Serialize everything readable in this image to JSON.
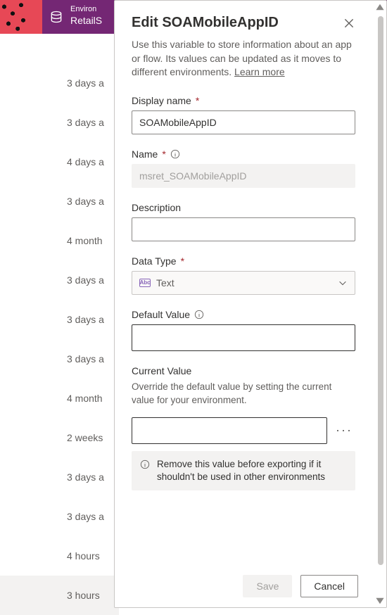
{
  "header": {
    "env_label": "Environ",
    "env_name": "RetailS"
  },
  "bg_list": {
    "items": [
      {
        "time": "3 days a"
      },
      {
        "time": "3 days a"
      },
      {
        "time": "4 days a"
      },
      {
        "time": "3 days a"
      },
      {
        "time": "4 month"
      },
      {
        "time": "3 days a"
      },
      {
        "time": "3 days a"
      },
      {
        "time": "3 days a"
      },
      {
        "time": "4 month"
      },
      {
        "time": "2 weeks"
      },
      {
        "time": "3 days a"
      },
      {
        "time": "3 days a"
      },
      {
        "time": "4 hours"
      },
      {
        "time": "3 hours"
      }
    ],
    "selected_index": 13
  },
  "panel": {
    "title": "Edit SOAMobileAppID",
    "description": "Use this variable to store information about an app or flow. Its values can be updated as it moves to different environments.",
    "learn_more": "Learn more",
    "fields": {
      "display_name": {
        "label": "Display name",
        "value": "SOAMobileAppID"
      },
      "name": {
        "label": "Name",
        "value": "msret_SOAMobileAppID"
      },
      "description": {
        "label": "Description",
        "value": ""
      },
      "data_type": {
        "label": "Data Type",
        "icon_text": "Abc",
        "value": "Text"
      },
      "default_value": {
        "label": "Default Value",
        "value": ""
      },
      "current_value": {
        "label": "Current Value",
        "note": "Override the default value by setting the current value for your environment.",
        "value": "",
        "warning": "Remove this value before exporting if it shouldn't be used in other environments"
      }
    },
    "buttons": {
      "save": "Save",
      "cancel": "Cancel"
    }
  }
}
